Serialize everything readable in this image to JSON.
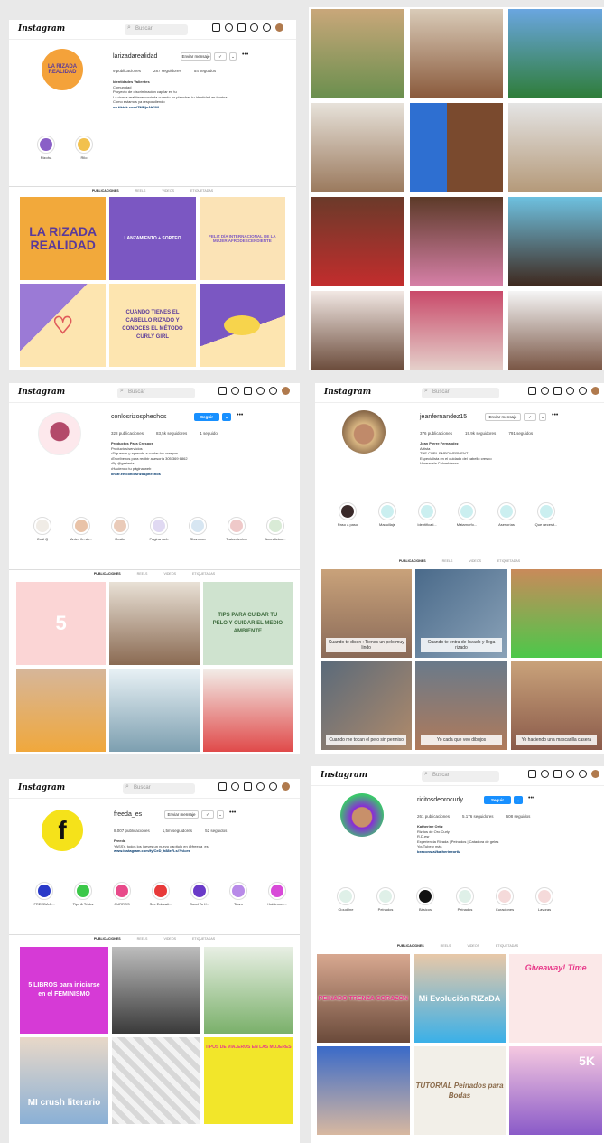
{
  "logo_text": "Instagram",
  "search_placeholder": "Buscar",
  "p1": {
    "username": "larizadarealidad",
    "msg_btn": "Enviar mensaje",
    "more": "•••",
    "stats": [
      "9 publicaciones",
      "287 seguidores",
      "54 seguidos"
    ],
    "bio_name": "Identidades Valientes",
    "bio_lines": [
      "Comunidad",
      "Proyecto de discriminación capilar en tu",
      "La rizada real tiene contada cuando no planchas tu identidad es tirorisa",
      "Como estamos ya respondiendo",
      "on.tiktok.com/ZMRjvAK1W"
    ],
    "highlights": [
      {
        "label": "Rizoha"
      },
      {
        "label": "Rilo"
      }
    ],
    "tabs": [
      "PUBLICACIONES",
      "REELS",
      "VIDEOS",
      "ETIQUETADAS"
    ],
    "tiles": [
      "LA RIZADA REALIDAD",
      "LANZAMIENTO + SORTEO",
      "FELIZ DÍA INTERNACIONAL DE LA MUJER AFRODESCENDIENTE",
      "",
      "CUANDO TIENES EL CABELLO RIZADO Y CONOCES EL MÉTODO CURLY GIRL",
      ""
    ]
  },
  "p3": {
    "username": "conlosrizosphechos",
    "follow_btn": "Seguir",
    "stats": [
      "328 publicaciones",
      "83,5k seguidores",
      "1 seguido"
    ],
    "bio_name": "Productos Para Crespos",
    "bio_lines": [
      "Productos/servicios",
      "•Síguenos y aprende a cuidar tus crespos",
      "•Escríbenos para recibir asesoría 305 369 6862",
      "•By @geriania",
      "•Haciendo tu página web",
      "linktr.ee/conlosrizosphechos"
    ],
    "highlights": [
      {
        "label": "Cuál Q"
      },
      {
        "label": "Antes fin sh..."
      },
      {
        "label": "Rosita"
      },
      {
        "label": "Pagina web"
      },
      {
        "label": "Shampoo"
      },
      {
        "label": "Tratamientos"
      },
      {
        "label": "Acondicion..."
      }
    ],
    "tabs": [
      "PUBLICACIONES",
      "REELS",
      "VIDEOS",
      "ETIQUETADAS"
    ],
    "tiles": [
      "5",
      "",
      "TIPS PARA CUIDAR TU PELO Y CUIDAR EL MEDIO AMBIENTE",
      "",
      "",
      ""
    ]
  },
  "p4": {
    "username": "jeanfernandez15",
    "msg_btn": "Enviar mensaje",
    "stats": [
      "376 publicaciones",
      "19.9k seguidores",
      "791 seguidos"
    ],
    "bio_name": "Jean Pierre Fernandez",
    "bio_lines": [
      "Artista",
      "THE CURL EMPOWERMENT",
      "Especialista en el cuidado del cabello crespo",
      "Venezuela Colombiaxxx"
    ],
    "highlights": [
      {
        "label": "Paso a paso"
      },
      {
        "label": "Maquillaje"
      },
      {
        "label": "Identificati..."
      },
      {
        "label": "Matamorfo..."
      },
      {
        "label": "Asesorías"
      },
      {
        "label": "Que necesit..."
      }
    ],
    "tabs": [
      "PUBLICACIONES",
      "REELS",
      "VIDEOS",
      "ETIQUETADAS"
    ],
    "captions": [
      "Cuando te dicen : Tienes un pelo muy lindo",
      "Cuando te entra de lavado y llega rizado",
      "",
      "Cuando me tocan el pelo sin permiso",
      "Yo cada que veo dibujos",
      "Yo haciendo una mascarilla casera"
    ]
  },
  "p5": {
    "username": "freeda_es",
    "msg_btn": "Enviar mensaje",
    "stats": [
      "8.007 publicaciones",
      "1,5m seguidores",
      "52 seguidos"
    ],
    "bio_name": "Freeda",
    "bio_lines": [
      "YASSY, todos los jueves un nuevo capítulo en @freeda_es",
      "www.instagram.com/fy/CeD_h88e7Ls/?hl=es"
    ],
    "highlights": [
      {
        "label": "FREEDA &..."
      },
      {
        "label": "Tips & Tricks"
      },
      {
        "label": "CURROS"
      },
      {
        "label": "Sex Educati..."
      },
      {
        "label": "Good To K..."
      },
      {
        "label": "Team"
      },
      {
        "label": "Hablemos..."
      }
    ],
    "tabs": [
      "PUBLICACIONES",
      "REELS",
      "VIDEOS",
      "ETIQUETADAS"
    ],
    "tiles": [
      "5 LIBROS para iniciarse en el FEMINISMO",
      "",
      "",
      "MI crush literario",
      "",
      "TIPOS DE VIAJEROS EN LAS MUJERES"
    ]
  },
  "p6": {
    "username": "ricitosdeorocurly",
    "follow_btn": "Seguir",
    "stats": [
      "261 publicaciones",
      "5.176 seguidores",
      "608 seguidos"
    ],
    "bio_name": "Katherine Ortiz",
    "bio_lines": [
      "Rizitos de Oro Curly",
      "R.D.esr",
      "Experiencia Rizada | Peinados | Catadora de geles",
      "YouTube y más",
      "beacons.ai/katherineortiz"
    ],
    "highlights": [
      {
        "label": "Cloudfine"
      },
      {
        "label": "Peinados"
      },
      {
        "label": "Básicos"
      },
      {
        "label": "Peinados"
      },
      {
        "label": "Curaciones"
      },
      {
        "label": "Lavoras"
      }
    ],
    "tabs": [
      "PUBLICACIONES",
      "REELS",
      "VIDEOS",
      "ETIQUETADAS"
    ],
    "tiles": [
      "PEINADO TRENZA CORAZÓN",
      "Mi Evolución RIZaDA",
      "Giveaway! Time",
      "",
      "TUTORIAL Peinados para Bodas",
      "5K"
    ]
  }
}
